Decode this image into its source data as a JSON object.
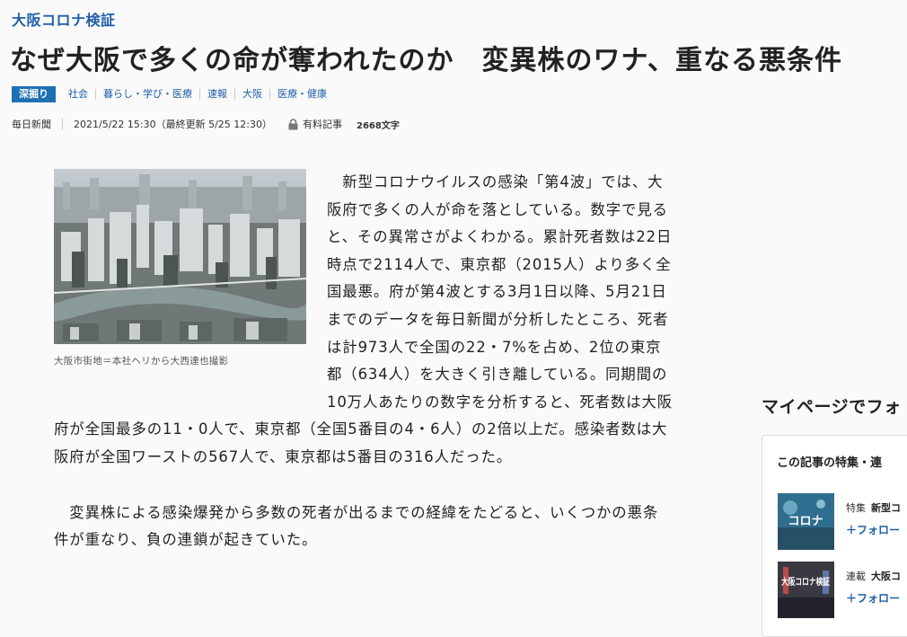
{
  "article": {
    "series": "大阪コロナ検証",
    "title": "なぜ大阪で多くの命が奪われたのか　変異株のワナ、重なる悪条件",
    "badge": "深掘り",
    "tags": [
      "社会",
      "暮らし・学び・医療",
      "速報",
      "大阪",
      "医療・健康"
    ],
    "publisher": "毎日新聞",
    "date": "2021/5/22 15:30（最終更新 5/25 12:30）",
    "paid_label": "有料記事",
    "char_count": "2668文字",
    "image_caption": "大阪市街地＝本社ヘリから大西達也撮影",
    "paragraph1": "　新型コロナウイルスの感染「第4波」では、大阪府で多くの人が命を落としている。数字で見ると、その異常さがよくわかる。累計死者数は22日時点で2114人で、東京都（2015人）より多く全国最悪。府が第4波とする3月1日以降、5月21日までのデータを毎日新聞が分析したところ、死者は計973人で全国の22・7%を占め、2位の東京都（634人）を大きく引き離している。同期間の10万人あたりの数字を分析すると、死者数は大阪府が全国最多の11・0人で、東京都（全国5番目の4・6人）の2倍以上だ。感染者数は大阪府が全国ワーストの567人で、東京都は5番目の316人だった。",
    "paragraph2": "　変異株による感染爆発から多数の死者が出るまでの経緯をたどると、いくつかの悪条件が重なり、負の連鎖が起きていた。"
  },
  "sidebar": {
    "follow_heading": "マイページでフォ",
    "panel_title": "この記事の特集・連",
    "items": [
      {
        "kind": "特集",
        "name": "新型コ",
        "follow": "＋フォロー",
        "thumb_text": "コロナ"
      },
      {
        "kind": "連載",
        "name": "大阪コ",
        "follow": "＋フォロー",
        "thumb_text": "大阪コロナ検証"
      }
    ]
  },
  "colors": {
    "accent": "#1f5fa8",
    "badge": "#1f6fb5"
  },
  "icons": {
    "paid": "lock-icon",
    "photo": "city-aerial-photo"
  }
}
